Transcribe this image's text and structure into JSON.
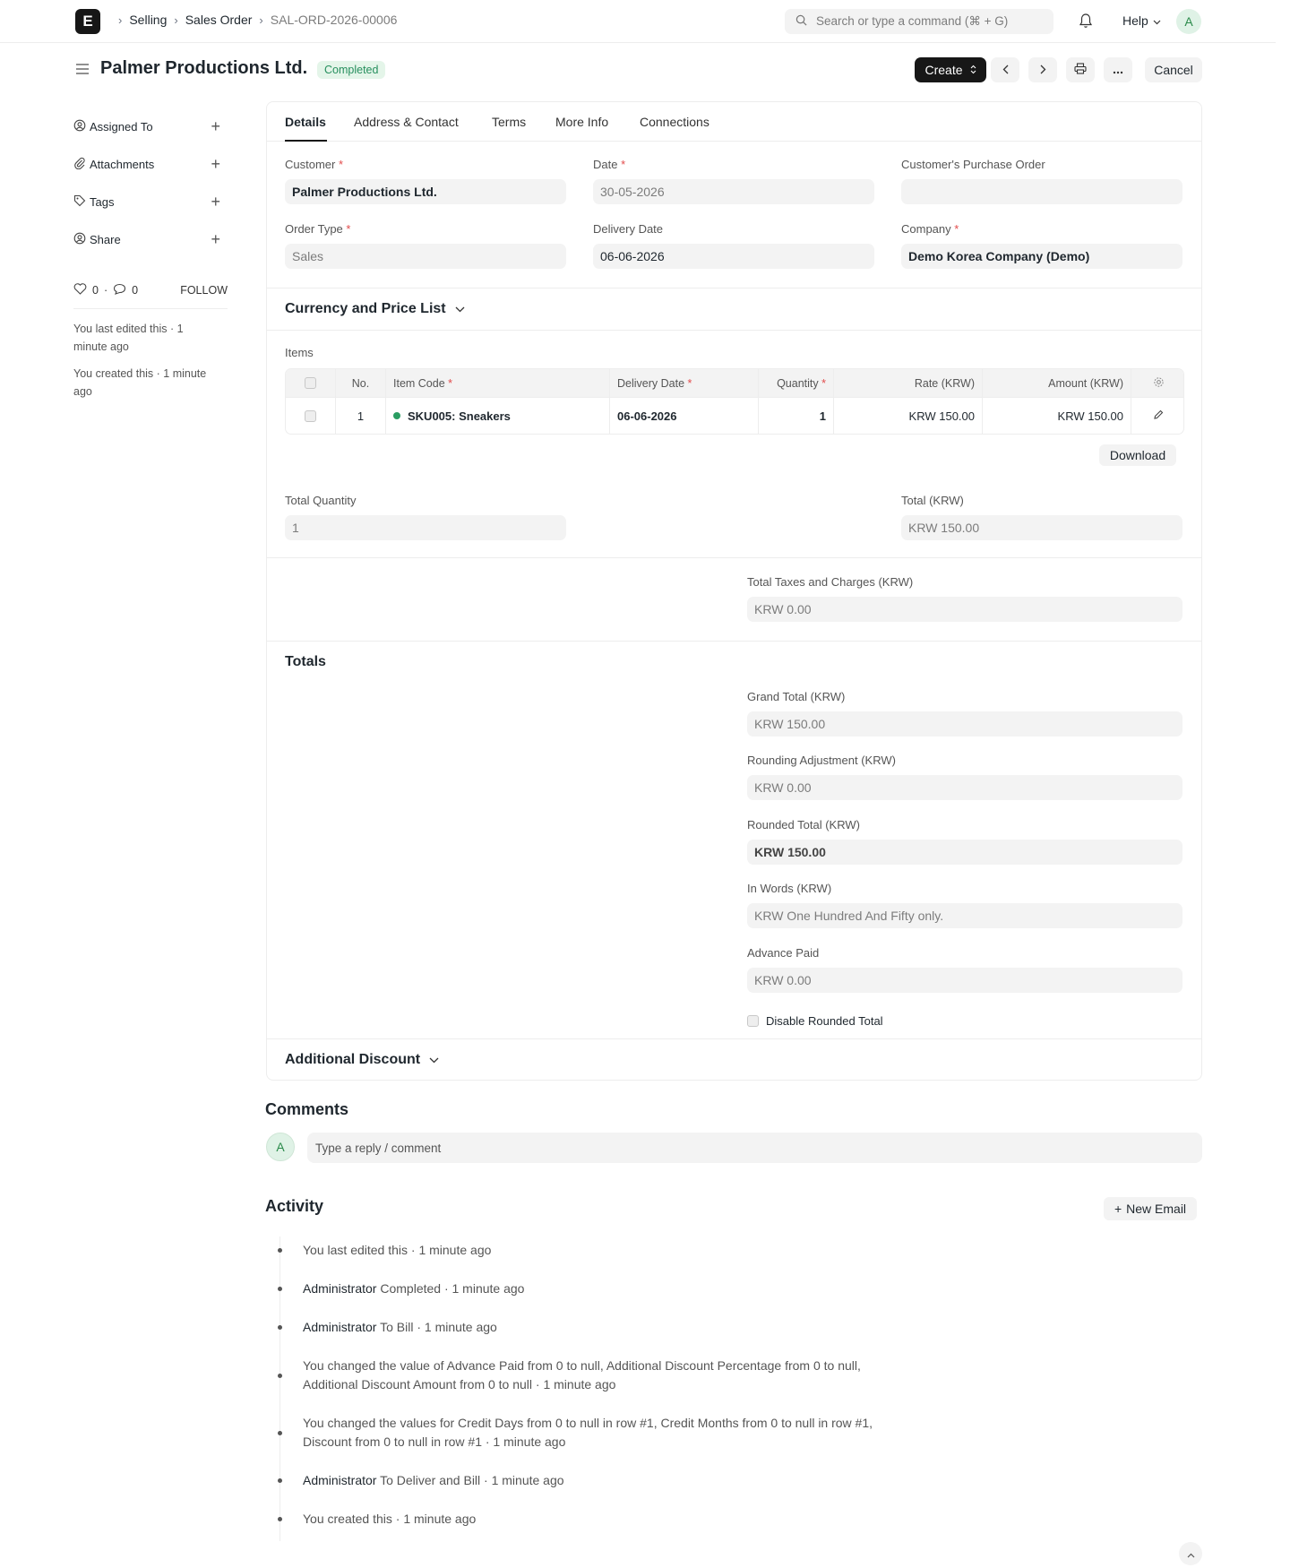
{
  "navbar": {
    "logo": "E",
    "breadcrumbs": [
      "Selling",
      "Sales Order",
      "SAL-ORD-2026-00006"
    ],
    "search_placeholder": "Search or type a command (⌘ + G)",
    "help_label": "Help",
    "avatar": "A"
  },
  "header": {
    "title": "Palmer Productions Ltd.",
    "status": "Completed",
    "create_label": "Create",
    "cancel_label": "Cancel"
  },
  "sidebar": {
    "items": [
      {
        "label": "Assigned To"
      },
      {
        "label": "Attachments"
      },
      {
        "label": "Tags"
      },
      {
        "label": "Share"
      }
    ],
    "likes": "0",
    "comments": "0",
    "follow_label": "FOLLOW",
    "last_edited": "You last edited this · 1 minute ago",
    "created": "You created this · 1 minute ago"
  },
  "tabs": [
    "Details",
    "Address & Contact",
    "Terms",
    "More Info",
    "Connections"
  ],
  "form": {
    "customer": {
      "label": "Customer",
      "value": "Palmer Productions Ltd."
    },
    "date": {
      "label": "Date",
      "value": "30-05-2026"
    },
    "customer_po": {
      "label": "Customer's Purchase Order",
      "value": ""
    },
    "order_type": {
      "label": "Order Type",
      "value": "Sales"
    },
    "delivery_date": {
      "label": "Delivery Date",
      "value": "06-06-2026"
    },
    "company": {
      "label": "Company",
      "value": "Demo Korea Company (Demo)"
    },
    "currency_section": "Currency and Price List",
    "items_label": "Items",
    "total_quantity": {
      "label": "Total Quantity",
      "value": "1"
    },
    "total": {
      "label": "Total (KRW)",
      "value": "KRW 150.00"
    },
    "total_taxes": {
      "label": "Total Taxes and Charges (KRW)",
      "value": "KRW 0.00"
    },
    "totals_section": "Totals",
    "grand_total": {
      "label": "Grand Total (KRW)",
      "value": "KRW 150.00"
    },
    "rounding_adjustment": {
      "label": "Rounding Adjustment (KRW)",
      "value": "KRW 0.00"
    },
    "rounded_total": {
      "label": "Rounded Total (KRW)",
      "value": "KRW 150.00"
    },
    "in_words": {
      "label": "In Words (KRW)",
      "value": "KRW One Hundred And Fifty only."
    },
    "advance_paid": {
      "label": "Advance Paid",
      "value": "KRW 0.00"
    },
    "disable_rounded_total": "Disable Rounded Total",
    "additional_discount_section": "Additional Discount"
  },
  "items_table": {
    "headers": [
      "No.",
      "Item Code",
      "Delivery Date",
      "Quantity",
      "Rate (KRW)",
      "Amount (KRW)"
    ],
    "rows": [
      {
        "no": "1",
        "item_code": "SKU005: Sneakers",
        "delivery_date": "06-06-2026",
        "quantity": "1",
        "rate": "KRW 150.00",
        "amount": "KRW 150.00"
      }
    ],
    "download_label": "Download"
  },
  "comments": {
    "title": "Comments",
    "avatar": "A",
    "placeholder": "Type a reply / comment"
  },
  "activity": {
    "title": "Activity",
    "new_email_label": "New Email",
    "items": [
      {
        "text": "You last edited this · 1 minute ago"
      },
      {
        "user": "Administrator",
        "text": " Completed · 1 minute ago"
      },
      {
        "user": "Administrator",
        "text": " To Bill · 1 minute ago"
      },
      {
        "line1": "You changed the value of Advance Paid from 0 to null, Additional Discount Percentage from 0 to null,",
        "line2": "Additional Discount Amount from 0 to null · 1 minute ago"
      },
      {
        "line1": "You changed the values for Credit Days from 0 to null in row #1, Credit Months from 0 to null in row #1,",
        "line2": "Discount from 0 to null in row #1 · 1 minute ago"
      },
      {
        "user": "Administrator",
        "text": " To Deliver and Bill · 1 minute ago"
      },
      {
        "text": "You created this · 1 minute ago"
      }
    ]
  },
  "colors": {
    "status_green": "#278f5e",
    "primary_button": "#171717",
    "required": "#e24c4c"
  }
}
